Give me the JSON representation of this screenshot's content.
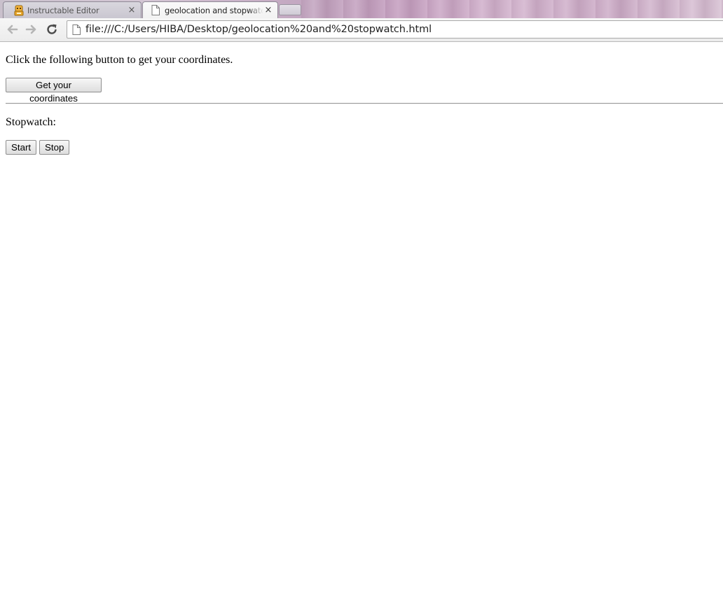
{
  "browser": {
    "tabs": [
      {
        "title": "Instructable Editor",
        "active": false,
        "icon": "robot-icon"
      },
      {
        "title": "geolocation and stopwatch",
        "active": true,
        "icon": "page-icon"
      }
    ],
    "close_glyph": "×",
    "address_bar": {
      "url": "file:///C:/Users/HIBA/Desktop/geolocation%20and%20stopwatch.html"
    }
  },
  "page": {
    "geolocation": {
      "instruction": "Click the following button to get your coordinates.",
      "button_label": "Get your coordinates"
    },
    "stopwatch": {
      "label": "Stopwatch:",
      "start_label": "Start",
      "stop_label": "Stop"
    }
  }
}
